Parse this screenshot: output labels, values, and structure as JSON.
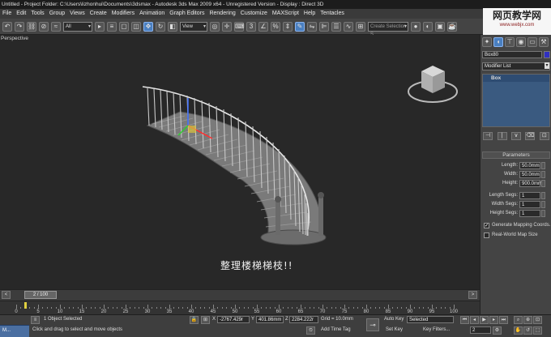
{
  "window": {
    "title": "Untitled    - Project Folder: C:\\Users\\lizhonhui\\Documents\\3dsmax     - Autodesk 3ds Max  2009 x64  - Unregistered Version     - Display : Direct 3D"
  },
  "watermark": {
    "line1": "网页教学网",
    "line2": "www.webjx.com"
  },
  "menu": [
    "File",
    "Edit",
    "Tools",
    "Group",
    "Views",
    "Create",
    "Modifiers",
    "Animation",
    "Graph Editors",
    "Rendering",
    "Customize",
    "MAXScript",
    "Help",
    "Tentacles"
  ],
  "toolbar": {
    "selection_filter": "All",
    "ref_coord": "View",
    "named_selection_placeholder": "Create Selection S"
  },
  "viewport": {
    "label": "Perspective",
    "caption": "整理楼梯梯枝!!"
  },
  "command_panel": {
    "object_name": "Box80",
    "modifier_list": "Modifier List",
    "stack_item": "Box",
    "params_title": "Parameters",
    "length_label": "Length:",
    "length_value": "50.0mm",
    "width_label": "Width:",
    "width_value": "50.0mm",
    "height_label": "Height:",
    "height_value": "900.0mm",
    "lsegs_label": "Length Segs:",
    "lsegs_value": "1",
    "wsegs_label": "Width Segs:",
    "wsegs_value": "1",
    "hsegs_label": "Height Segs:",
    "hsegs_value": "1",
    "gen_map_label": "Generate Mapping Coords.",
    "gen_map_checked": true,
    "real_world_label": "Real-World Map Size",
    "real_world_checked": false
  },
  "timeslider": {
    "frame": "2 / 100"
  },
  "ruler": {
    "ticks": [
      "0",
      "5",
      "10",
      "15",
      "20",
      "25",
      "30",
      "35",
      "40",
      "45",
      "50",
      "55",
      "60",
      "65",
      "70",
      "75",
      "80",
      "85",
      "90",
      "95",
      "100"
    ]
  },
  "status": {
    "selected": "1 Object Selected",
    "prompt": "Click and drag to select and move objects",
    "x": "-2767.429r",
    "y": "401.86mm",
    "z": "2284.222r",
    "grid": "Grid = 10.0mm",
    "add_time_tag": "Add Time Tag",
    "auto_key": "Auto Key",
    "auto_key_mode": "Selected",
    "set_key": "Set Key",
    "key_filters": "Key Filters...",
    "frame": "2"
  },
  "taskbar": {
    "item": "M..."
  },
  "colors": {
    "viewport_bg": "#282828",
    "accent": "#4a7fc0",
    "stack_bg": "#3a5a80"
  }
}
